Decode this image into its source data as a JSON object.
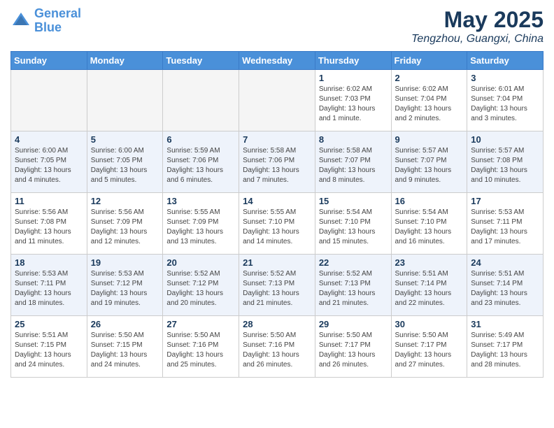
{
  "header": {
    "logo_line1": "General",
    "logo_line2": "Blue",
    "month": "May 2025",
    "location": "Tengzhou, Guangxi, China"
  },
  "weekdays": [
    "Sunday",
    "Monday",
    "Tuesday",
    "Wednesday",
    "Thursday",
    "Friday",
    "Saturday"
  ],
  "weeks": [
    [
      {
        "day": "",
        "info": ""
      },
      {
        "day": "",
        "info": ""
      },
      {
        "day": "",
        "info": ""
      },
      {
        "day": "",
        "info": ""
      },
      {
        "day": "1",
        "info": "Sunrise: 6:02 AM\nSunset: 7:03 PM\nDaylight: 13 hours and 1 minute."
      },
      {
        "day": "2",
        "info": "Sunrise: 6:02 AM\nSunset: 7:04 PM\nDaylight: 13 hours and 2 minutes."
      },
      {
        "day": "3",
        "info": "Sunrise: 6:01 AM\nSunset: 7:04 PM\nDaylight: 13 hours and 3 minutes."
      }
    ],
    [
      {
        "day": "4",
        "info": "Sunrise: 6:00 AM\nSunset: 7:05 PM\nDaylight: 13 hours and 4 minutes."
      },
      {
        "day": "5",
        "info": "Sunrise: 6:00 AM\nSunset: 7:05 PM\nDaylight: 13 hours and 5 minutes."
      },
      {
        "day": "6",
        "info": "Sunrise: 5:59 AM\nSunset: 7:06 PM\nDaylight: 13 hours and 6 minutes."
      },
      {
        "day": "7",
        "info": "Sunrise: 5:58 AM\nSunset: 7:06 PM\nDaylight: 13 hours and 7 minutes."
      },
      {
        "day": "8",
        "info": "Sunrise: 5:58 AM\nSunset: 7:07 PM\nDaylight: 13 hours and 8 minutes."
      },
      {
        "day": "9",
        "info": "Sunrise: 5:57 AM\nSunset: 7:07 PM\nDaylight: 13 hours and 9 minutes."
      },
      {
        "day": "10",
        "info": "Sunrise: 5:57 AM\nSunset: 7:08 PM\nDaylight: 13 hours and 10 minutes."
      }
    ],
    [
      {
        "day": "11",
        "info": "Sunrise: 5:56 AM\nSunset: 7:08 PM\nDaylight: 13 hours and 11 minutes."
      },
      {
        "day": "12",
        "info": "Sunrise: 5:56 AM\nSunset: 7:09 PM\nDaylight: 13 hours and 12 minutes."
      },
      {
        "day": "13",
        "info": "Sunrise: 5:55 AM\nSunset: 7:09 PM\nDaylight: 13 hours and 13 minutes."
      },
      {
        "day": "14",
        "info": "Sunrise: 5:55 AM\nSunset: 7:10 PM\nDaylight: 13 hours and 14 minutes."
      },
      {
        "day": "15",
        "info": "Sunrise: 5:54 AM\nSunset: 7:10 PM\nDaylight: 13 hours and 15 minutes."
      },
      {
        "day": "16",
        "info": "Sunrise: 5:54 AM\nSunset: 7:10 PM\nDaylight: 13 hours and 16 minutes."
      },
      {
        "day": "17",
        "info": "Sunrise: 5:53 AM\nSunset: 7:11 PM\nDaylight: 13 hours and 17 minutes."
      }
    ],
    [
      {
        "day": "18",
        "info": "Sunrise: 5:53 AM\nSunset: 7:11 PM\nDaylight: 13 hours and 18 minutes."
      },
      {
        "day": "19",
        "info": "Sunrise: 5:53 AM\nSunset: 7:12 PM\nDaylight: 13 hours and 19 minutes."
      },
      {
        "day": "20",
        "info": "Sunrise: 5:52 AM\nSunset: 7:12 PM\nDaylight: 13 hours and 20 minutes."
      },
      {
        "day": "21",
        "info": "Sunrise: 5:52 AM\nSunset: 7:13 PM\nDaylight: 13 hours and 21 minutes."
      },
      {
        "day": "22",
        "info": "Sunrise: 5:52 AM\nSunset: 7:13 PM\nDaylight: 13 hours and 21 minutes."
      },
      {
        "day": "23",
        "info": "Sunrise: 5:51 AM\nSunset: 7:14 PM\nDaylight: 13 hours and 22 minutes."
      },
      {
        "day": "24",
        "info": "Sunrise: 5:51 AM\nSunset: 7:14 PM\nDaylight: 13 hours and 23 minutes."
      }
    ],
    [
      {
        "day": "25",
        "info": "Sunrise: 5:51 AM\nSunset: 7:15 PM\nDaylight: 13 hours and 24 minutes."
      },
      {
        "day": "26",
        "info": "Sunrise: 5:50 AM\nSunset: 7:15 PM\nDaylight: 13 hours and 24 minutes."
      },
      {
        "day": "27",
        "info": "Sunrise: 5:50 AM\nSunset: 7:16 PM\nDaylight: 13 hours and 25 minutes."
      },
      {
        "day": "28",
        "info": "Sunrise: 5:50 AM\nSunset: 7:16 PM\nDaylight: 13 hours and 26 minutes."
      },
      {
        "day": "29",
        "info": "Sunrise: 5:50 AM\nSunset: 7:17 PM\nDaylight: 13 hours and 26 minutes."
      },
      {
        "day": "30",
        "info": "Sunrise: 5:50 AM\nSunset: 7:17 PM\nDaylight: 13 hours and 27 minutes."
      },
      {
        "day": "31",
        "info": "Sunrise: 5:49 AM\nSunset: 7:17 PM\nDaylight: 13 hours and 28 minutes."
      }
    ]
  ]
}
